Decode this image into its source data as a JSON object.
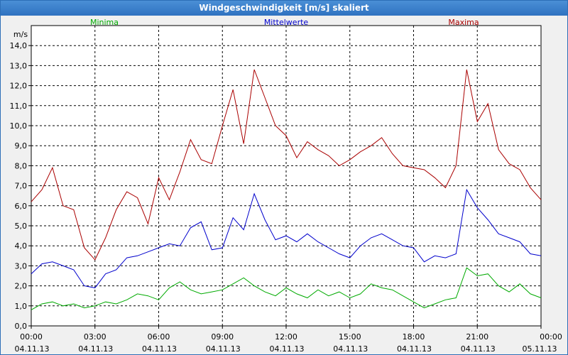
{
  "window": {
    "title": "Windgeschwindigkeit [m/s] skaliert"
  },
  "chart_data": {
    "type": "line",
    "title": "Windgeschwindigkeit [m/s] skaliert",
    "ylabel": "m/s",
    "xlabel": "",
    "ylim": [
      0,
      15
    ],
    "xlim": [
      0,
      24
    ],
    "yticks": [
      0,
      1,
      2,
      3,
      4,
      5,
      6,
      7,
      8,
      9,
      10,
      11,
      12,
      13,
      14
    ],
    "ytick_labels": [
      "0,0",
      "1,0",
      "2,0",
      "3,0",
      "4,0",
      "5,0",
      "6,0",
      "7,0",
      "8,0",
      "9,0",
      "10,0",
      "11,0",
      "12,0",
      "13,0",
      "14,0"
    ],
    "xticks": [
      0,
      3,
      6,
      9,
      12,
      15,
      18,
      21,
      24
    ],
    "xtick_times": [
      "00:00",
      "03:00",
      "06:00",
      "09:00",
      "12:00",
      "15:00",
      "18:00",
      "21:00",
      "00:00"
    ],
    "xtick_dates": [
      "04.11.13",
      "04.11.13",
      "04.11.13",
      "04.11.13",
      "04.11.13",
      "04.11.13",
      "04.11.13",
      "04.11.13",
      "05.11.13"
    ],
    "grid": true,
    "legend_position": "top",
    "series": [
      {
        "name": "Minima",
        "color": "#00aa00",
        "x": [
          0,
          0.5,
          1,
          1.5,
          2,
          2.5,
          3,
          3.5,
          4,
          4.5,
          5,
          5.5,
          6,
          6.5,
          7,
          7.5,
          8,
          8.5,
          9,
          9.5,
          10,
          10.5,
          11,
          11.5,
          12,
          12.5,
          13,
          13.5,
          14,
          14.5,
          15,
          15.5,
          16,
          16.5,
          17,
          17.5,
          18,
          18.5,
          19,
          19.5,
          20,
          20.5,
          21,
          21.5,
          22,
          22.5,
          23,
          23.5,
          24
        ],
        "y": [
          0.8,
          1.1,
          1.2,
          1.0,
          1.1,
          0.9,
          1.0,
          1.2,
          1.1,
          1.3,
          1.6,
          1.5,
          1.3,
          1.9,
          2.2,
          1.8,
          1.6,
          1.7,
          1.8,
          2.1,
          2.4,
          2.0,
          1.7,
          1.5,
          1.9,
          1.6,
          1.4,
          1.8,
          1.5,
          1.7,
          1.4,
          1.6,
          2.1,
          1.9,
          1.8,
          1.5,
          1.2,
          0.9,
          1.1,
          1.3,
          1.4,
          2.9,
          2.5,
          2.6,
          2.0,
          1.7,
          2.1,
          1.6,
          1.4
        ]
      },
      {
        "name": "Mittelwerte",
        "color": "#0000cc",
        "x": [
          0,
          0.5,
          1,
          1.5,
          2,
          2.5,
          3,
          3.5,
          4,
          4.5,
          5,
          5.5,
          6,
          6.5,
          7,
          7.5,
          8,
          8.5,
          9,
          9.5,
          10,
          10.5,
          11,
          11.5,
          12,
          12.5,
          13,
          13.5,
          14,
          14.5,
          15,
          15.5,
          16,
          16.5,
          17,
          17.5,
          18,
          18.5,
          19,
          19.5,
          20,
          20.5,
          21,
          21.5,
          22,
          22.5,
          23,
          23.5,
          24
        ],
        "y": [
          2.6,
          3.1,
          3.2,
          3.0,
          2.8,
          2.0,
          1.9,
          2.6,
          2.8,
          3.4,
          3.5,
          3.7,
          3.9,
          4.1,
          4.0,
          4.9,
          5.2,
          3.8,
          3.9,
          5.4,
          4.8,
          6.6,
          5.3,
          4.3,
          4.5,
          4.2,
          4.6,
          4.2,
          3.9,
          3.6,
          3.4,
          4.0,
          4.4,
          4.6,
          4.3,
          4.0,
          3.9,
          3.2,
          3.5,
          3.4,
          3.6,
          6.8,
          5.9,
          5.3,
          4.6,
          4.4,
          4.2,
          3.6,
          3.5
        ]
      },
      {
        "name": "Maxima",
        "color": "#aa0000",
        "x": [
          0,
          0.5,
          1,
          1.5,
          2,
          2.5,
          3,
          3.5,
          4,
          4.5,
          5,
          5.5,
          6,
          6.5,
          7,
          7.5,
          8,
          8.5,
          9,
          9.5,
          10,
          10.5,
          11,
          11.5,
          12,
          12.5,
          13,
          13.5,
          14,
          14.5,
          15,
          15.5,
          16,
          16.5,
          17,
          17.5,
          18,
          18.5,
          19,
          19.5,
          20,
          20.5,
          21,
          21.5,
          22,
          22.5,
          23,
          23.5,
          24
        ],
        "y": [
          6.2,
          6.8,
          7.9,
          6.0,
          5.8,
          3.9,
          3.3,
          4.4,
          5.8,
          6.7,
          6.4,
          5.1,
          7.4,
          6.3,
          7.7,
          9.3,
          8.3,
          8.1,
          10.0,
          11.8,
          9.1,
          12.8,
          11.4,
          10.0,
          9.5,
          8.4,
          9.2,
          8.8,
          8.5,
          8.0,
          8.3,
          8.7,
          9.0,
          9.4,
          8.6,
          8.0,
          7.9,
          7.8,
          7.4,
          6.9,
          8.0,
          12.8,
          10.2,
          11.1,
          8.8,
          8.1,
          7.8,
          6.9,
          6.3
        ]
      }
    ]
  }
}
